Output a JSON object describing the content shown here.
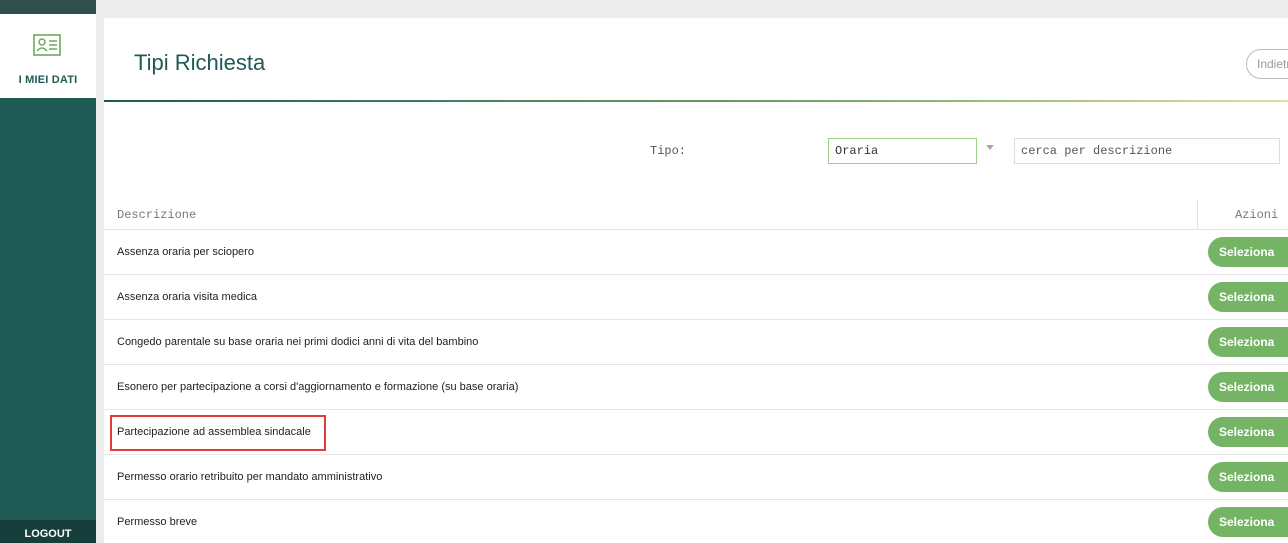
{
  "sidebar": {
    "profile_label": "I MIEI DATI",
    "profile_icon": "profile-card-icon",
    "logout_label": "LOGOUT"
  },
  "header": {
    "title": "Tipi Richiesta",
    "back_label": "Indietro"
  },
  "filters": {
    "type_label": "Tipo:",
    "type_value": "Oraria",
    "search_placeholder": "cerca per descrizione"
  },
  "table": {
    "columns": [
      "Descrizione",
      "Azioni"
    ],
    "action_label": "Seleziona",
    "rows": [
      {
        "description": "Assenza oraria per sciopero"
      },
      {
        "description": "Assenza oraria visita medica"
      },
      {
        "description": "Congedo parentale su base oraria nei primi dodici anni di vita del bambino"
      },
      {
        "description": "Esonero per partecipazione a corsi d'aggiornamento e formazione (su base oraria)"
      },
      {
        "description": "Partecipazione ad assemblea sindacale"
      },
      {
        "description": "Permesso orario retribuito per mandato amministrativo"
      },
      {
        "description": "Permesso breve"
      }
    ]
  },
  "colors": {
    "primary": "#1f5a55",
    "accent_green": "#74b464",
    "highlight_red": "#e23b3b"
  }
}
